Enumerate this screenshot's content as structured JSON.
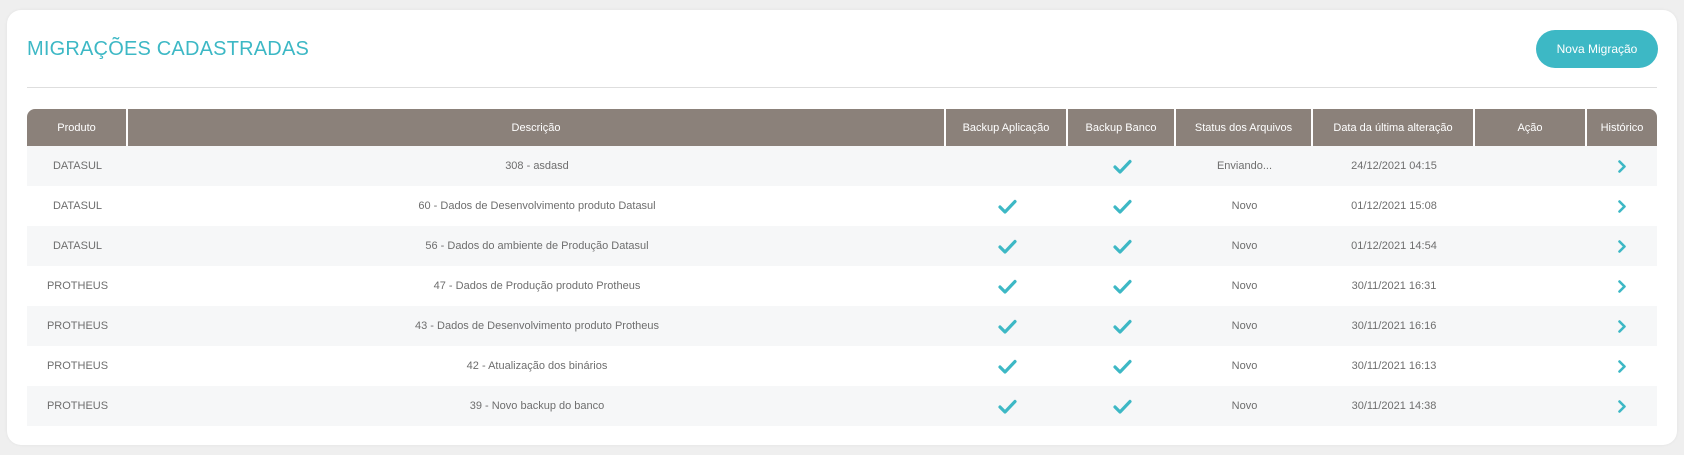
{
  "header": {
    "title": "MIGRAÇÕES CADASTRADAS",
    "new_button": "Nova Migração"
  },
  "colors": {
    "accent": "#3db8c5",
    "header_bg": "#8b817a"
  },
  "table": {
    "columns": [
      "Produto",
      "Descrição",
      "Backup Aplicação",
      "Backup Banco",
      "Status dos Arquivos",
      "Data da última alteração",
      "Ação",
      "Histórico"
    ],
    "rows": [
      {
        "produto": "DATASUL",
        "descricao": "308 - asdasd",
        "backup_app": false,
        "backup_db": true,
        "status": "Enviando...",
        "data": "24/12/2021 04:15"
      },
      {
        "produto": "DATASUL",
        "descricao": "60 - Dados de Desenvolvimento produto Datasul",
        "backup_app": true,
        "backup_db": true,
        "status": "Novo",
        "data": "01/12/2021 15:08"
      },
      {
        "produto": "DATASUL",
        "descricao": "56 - Dados do ambiente de Produção Datasul",
        "backup_app": true,
        "backup_db": true,
        "status": "Novo",
        "data": "01/12/2021 14:54"
      },
      {
        "produto": "PROTHEUS",
        "descricao": "47 - Dados de Produção produto Protheus",
        "backup_app": true,
        "backup_db": true,
        "status": "Novo",
        "data": "30/11/2021 16:31"
      },
      {
        "produto": "PROTHEUS",
        "descricao": "43 - Dados de Desenvolvimento produto Protheus",
        "backup_app": true,
        "backup_db": true,
        "status": "Novo",
        "data": "30/11/2021 16:16"
      },
      {
        "produto": "PROTHEUS",
        "descricao": "42 - Atualização dos binários",
        "backup_app": true,
        "backup_db": true,
        "status": "Novo",
        "data": "30/11/2021 16:13"
      },
      {
        "produto": "PROTHEUS",
        "descricao": "39 - Novo backup do banco",
        "backup_app": true,
        "backup_db": true,
        "status": "Novo",
        "data": "30/11/2021 14:38"
      }
    ]
  }
}
